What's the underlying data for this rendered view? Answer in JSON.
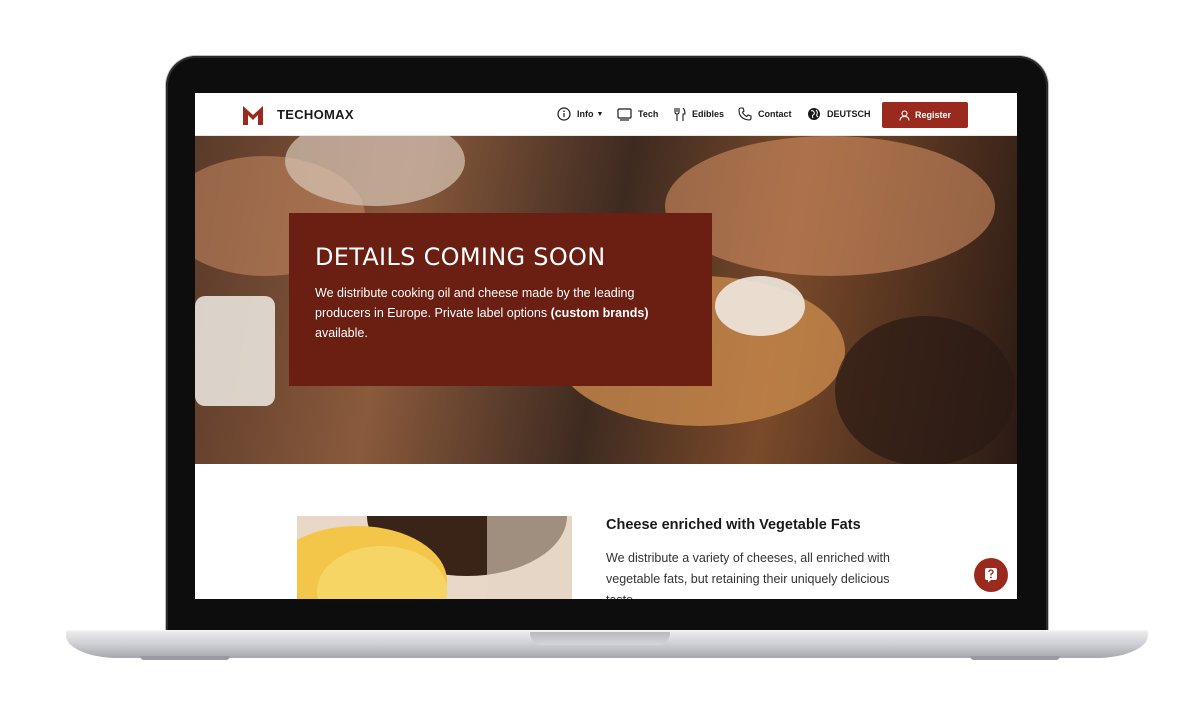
{
  "brand": {
    "name": "TECHOMAX",
    "color": "#9b2a1e"
  },
  "nav": {
    "info": {
      "label": "Info",
      "icon": "info-circle-icon"
    },
    "tech": {
      "label": "Tech",
      "icon": "monitor-icon"
    },
    "edibles": {
      "label": "Edibles",
      "icon": "cutlery-icon"
    },
    "contact": {
      "label": "Contact",
      "icon": "phone-icon"
    },
    "language": {
      "label": "DEUTSCH",
      "icon": "globe-icon"
    },
    "register": {
      "label": "Register",
      "icon": "user-icon"
    }
  },
  "hero": {
    "title": "DETAILS COMING SOON",
    "text_before": "We distribute cooking oil and cheese made by the leading producers in Europe. Private label options ",
    "text_bold": "(custom brands)",
    "text_after": " available.",
    "overlay_color": "#6b1e12"
  },
  "section": {
    "title": "Cheese enriched with Vegetable Fats",
    "text": "We distribute a variety of cheeses, all enriched with vegetable fats, but retaining their uniquely delicious taste."
  },
  "help_button": {
    "icon": "help-question-icon"
  }
}
